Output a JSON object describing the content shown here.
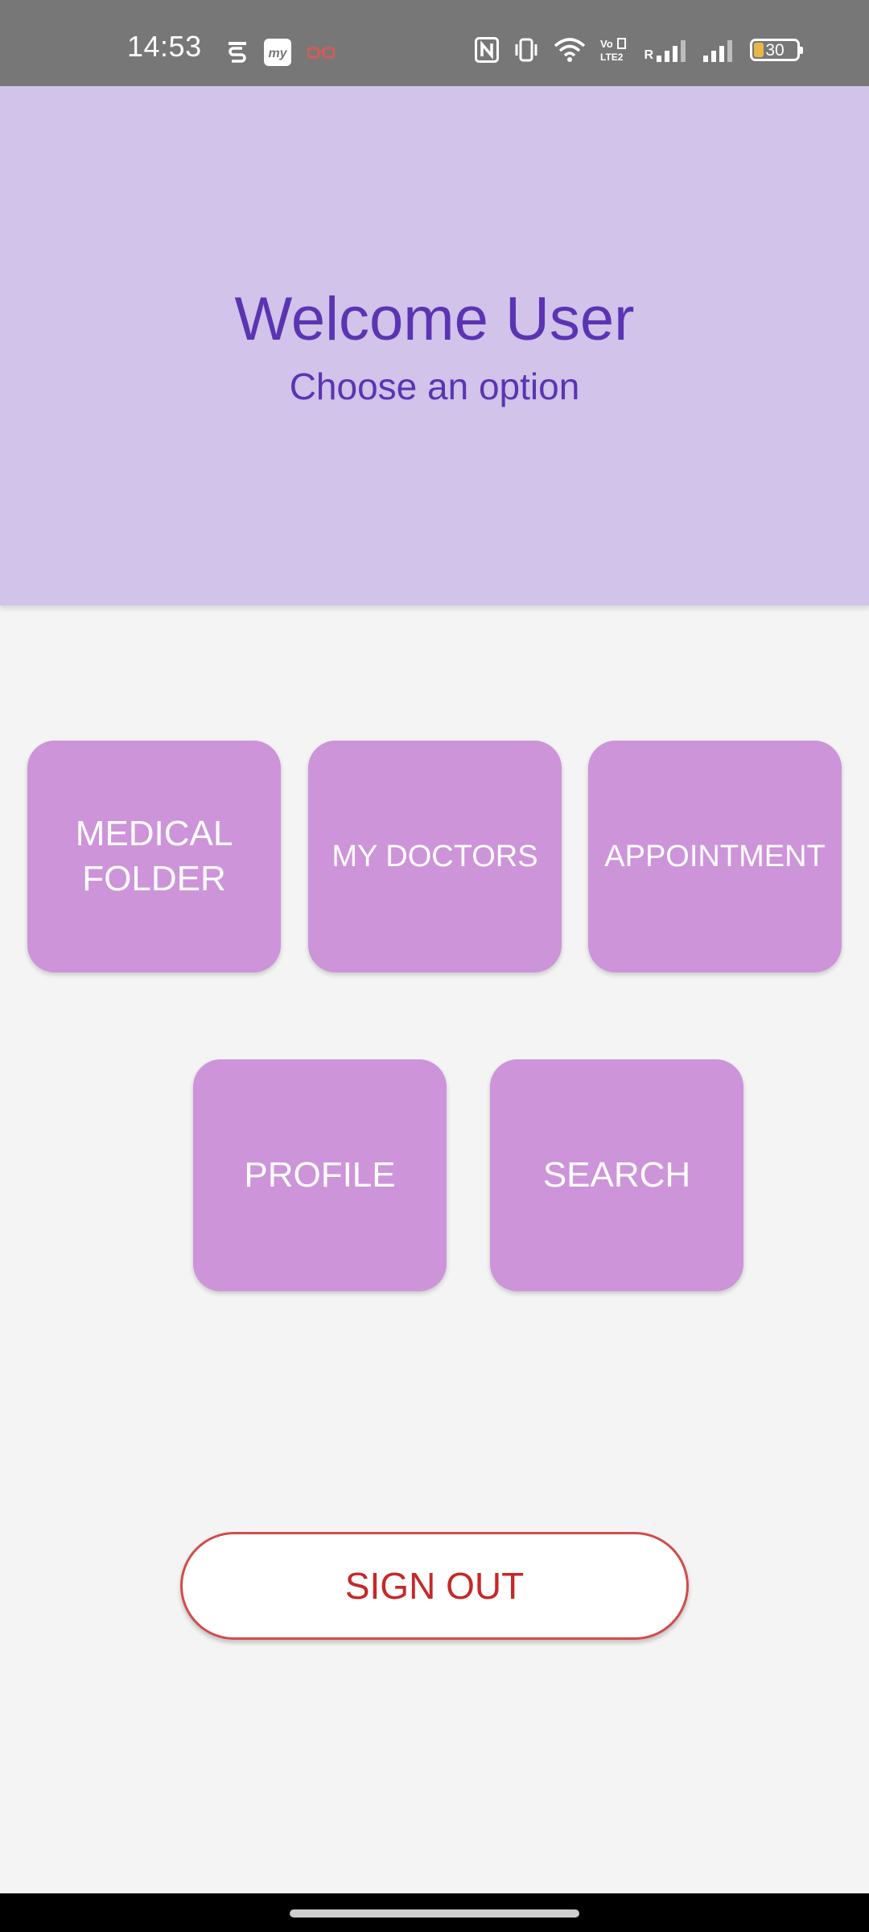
{
  "status_bar": {
    "time": "14:53",
    "left_icons": [
      "s-app-icon",
      "my-app-icon",
      "glasses-icon"
    ],
    "right_icons": [
      "nfc-icon",
      "vibrate-icon",
      "wifi-icon",
      "volte-icon",
      "signal-roaming-icon",
      "signal-icon"
    ],
    "battery_level": "30",
    "roaming_label": "R"
  },
  "header": {
    "title": "Welcome User",
    "subtitle": "Choose an option",
    "background_color": "#d1c3e9",
    "text_color": "#5b34b3"
  },
  "options": {
    "medical_folder": "MEDICAL FOLDER",
    "my_doctors": "MY DOCTORS",
    "appointment": "APPOINTMENT",
    "profile": "PROFILE",
    "search": "SEARCH",
    "tile_color": "#cd94da"
  },
  "sign_out": {
    "label": "SIGN OUT",
    "color": "#c62828"
  }
}
